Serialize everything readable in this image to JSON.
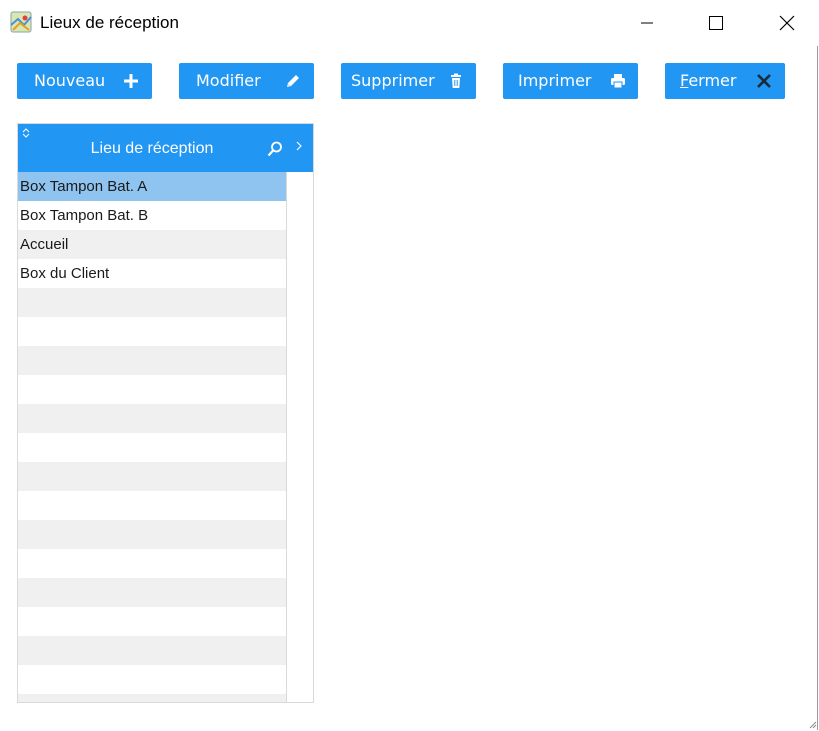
{
  "window": {
    "title": "Lieux de réception",
    "icon": "map-icon"
  },
  "toolbar": {
    "new_label": "Nouveau",
    "modify_label": "Modifier",
    "delete_label": "Supprimer",
    "print_label": "Imprimer",
    "close_label_first": "F",
    "close_label_rest": "ermer"
  },
  "grid": {
    "column_header": "Lieu de réception",
    "rows": [
      "Box Tampon Bat. A",
      "Box Tampon Bat. B",
      "Accueil",
      "Box du Client"
    ],
    "selected_row": 0
  },
  "colors": {
    "accent": "#2196f3",
    "selected_row": "#90c4f0",
    "stripe": "#f0f0f0"
  }
}
